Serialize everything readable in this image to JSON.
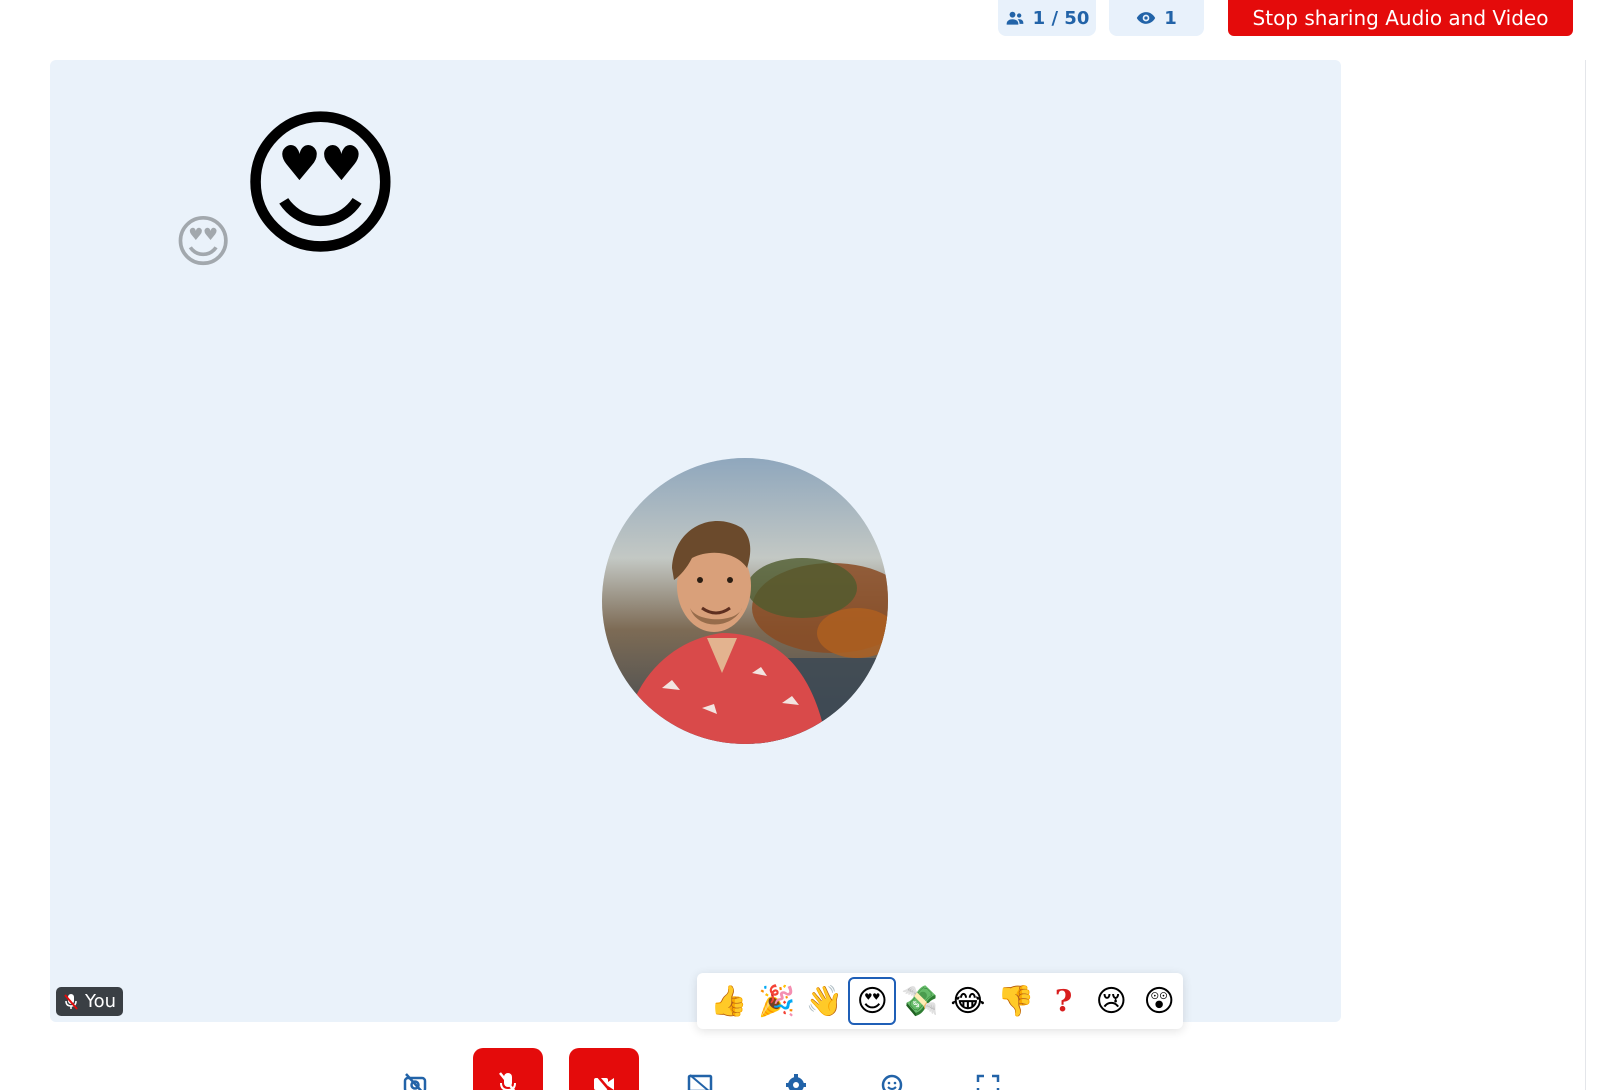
{
  "header": {
    "participants_count": "1 / 50",
    "viewers_count": "1",
    "stop_button_label": "Stop sharing Audio and Video"
  },
  "stage": {
    "self_label": "You",
    "floating_reactions": [
      "😍",
      "😍"
    ]
  },
  "reactions": [
    {
      "name": "thumbs-up",
      "glyph": "👍"
    },
    {
      "name": "party-popper",
      "glyph": "🎉"
    },
    {
      "name": "waving-hand",
      "glyph": "👋"
    },
    {
      "name": "heart-eyes",
      "glyph": "😍",
      "selected": true
    },
    {
      "name": "money-wings",
      "glyph": "💸"
    },
    {
      "name": "tears-of-joy",
      "glyph": "😂"
    },
    {
      "name": "thumbs-down",
      "glyph": "👎"
    },
    {
      "name": "question-mark",
      "glyph": "?"
    },
    {
      "name": "crying",
      "glyph": "😢"
    },
    {
      "name": "astonished",
      "glyph": "😲"
    }
  ],
  "colors": {
    "accent": "#2263a8",
    "danger": "#e40b0b",
    "stage_bg": "#eaf2fa",
    "selected_border": "#1f5fb7"
  },
  "controls": [
    {
      "name": "camera-off-icon",
      "active_red": false
    },
    {
      "name": "mic-off-icon",
      "active_red": true
    },
    {
      "name": "video-off-icon",
      "active_red": true
    },
    {
      "name": "screen-share-off-icon",
      "active_red": false
    },
    {
      "name": "gear-icon",
      "active_red": false
    },
    {
      "name": "emoji-icon",
      "active_red": false
    },
    {
      "name": "fullscreen-icon",
      "active_red": false
    }
  ]
}
